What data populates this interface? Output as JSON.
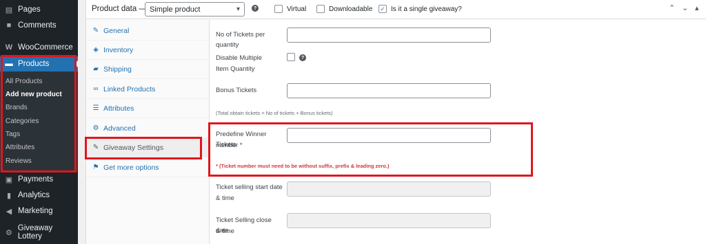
{
  "sidebar": {
    "items": [
      {
        "label": "Pages",
        "icon": "pages-icon"
      },
      {
        "label": "Comments",
        "icon": "comments-icon"
      },
      {
        "label": "WooCommerce",
        "icon": "woocommerce-icon"
      },
      {
        "label": "Products",
        "icon": "products-icon"
      },
      {
        "label": "Payments",
        "icon": "payments-icon"
      },
      {
        "label": "Analytics",
        "icon": "analytics-icon"
      },
      {
        "label": "Marketing",
        "icon": "marketing-icon"
      },
      {
        "label": "Giveaway Lottery",
        "icon": "giveaway-icon"
      }
    ],
    "submenu": [
      "All Products",
      "Add new product",
      "Brands",
      "Categories",
      "Tags",
      "Attributes",
      "Reviews"
    ],
    "current_submenu": "Add new product"
  },
  "header": {
    "title": "Product data —",
    "product_type": "Simple product",
    "virtual_label": "Virtual",
    "downloadable_label": "Downloadable",
    "giveaway_label": "Is it a single giveaway?",
    "giveaway_checked": true
  },
  "tabs": [
    {
      "label": "General",
      "icon": "wrench-icon"
    },
    {
      "label": "Inventory",
      "icon": "tag-icon"
    },
    {
      "label": "Shipping",
      "icon": "truck-icon"
    },
    {
      "label": "Linked Products",
      "icon": "link-icon"
    },
    {
      "label": "Attributes",
      "icon": "list-icon"
    },
    {
      "label": "Advanced",
      "icon": "gear-icon"
    },
    {
      "label": "Giveaway Settings",
      "icon": "wrench-icon"
    },
    {
      "label": "Get more options",
      "icon": "plugin-icon"
    }
  ],
  "active_tab": "Giveaway Settings",
  "fields": {
    "tickets_per_quantity": {
      "label": "No of Tickets per quantity",
      "value": ""
    },
    "disable_multiple": {
      "label_line1": "Disable Multiple",
      "label_line2": "Item Quantity",
      "checked": false
    },
    "bonus_tickets": {
      "label": "Bonus Tickets",
      "value": ""
    },
    "total_note": "(Total obtain tickets = No of tickets + Bonus tickets)",
    "predefine_winner": {
      "label_line1": "Predefine Winner Tickets",
      "label_line2": "number *",
      "value": ""
    },
    "winner_warning": "* (Ticket number must need to be without suffix, prefix & leading zero.)",
    "selling_start": {
      "label_line1": "Ticket selling start date",
      "label_line2": "& time",
      "value": ""
    },
    "selling_close": {
      "label_line1": "Ticket Selling close date",
      "label_line2": "& time",
      "value": ""
    }
  },
  "colors": {
    "accent": "#2271b1",
    "highlight": "#e0151d",
    "warning": "#d63638"
  }
}
